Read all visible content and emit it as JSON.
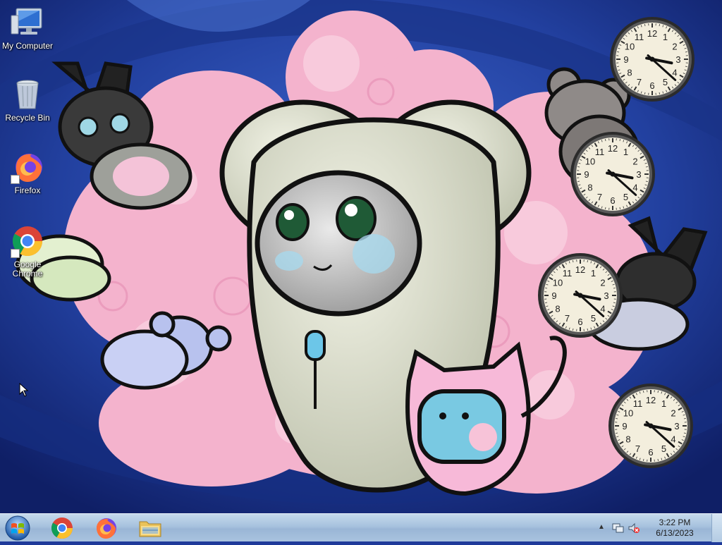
{
  "desktop": {
    "icons": [
      {
        "label": "My Computer",
        "icon": "computer-icon"
      },
      {
        "label": "Recycle Bin",
        "icon": "recycle-bin-icon"
      },
      {
        "label": "Firefox",
        "icon": "firefox-icon"
      },
      {
        "label": "Google Chrome",
        "icon": "chrome-icon"
      }
    ]
  },
  "gadgets": {
    "clock_count": 4,
    "time_shown": "3:22"
  },
  "taskbar": {
    "start_icon": "windows-orb-icon",
    "pinned": [
      {
        "name": "Google Chrome",
        "icon": "chrome-icon"
      },
      {
        "name": "Firefox",
        "icon": "firefox-icon"
      },
      {
        "name": "Windows Explorer",
        "icon": "folder-icon"
      }
    ],
    "tray": {
      "show_hidden_icon": "up-arrow-icon",
      "network_icon": "network-icon",
      "volume_icon": "volume-muted-icon",
      "time": "3:22 PM",
      "date": "6/13/2023"
    }
  },
  "colors": {
    "taskbar": "#a9c3df",
    "wallpaper_blue": "#1f3a9a",
    "wallpaper_pink": "#f4b3cd",
    "clock_face": "#f3eedd"
  }
}
